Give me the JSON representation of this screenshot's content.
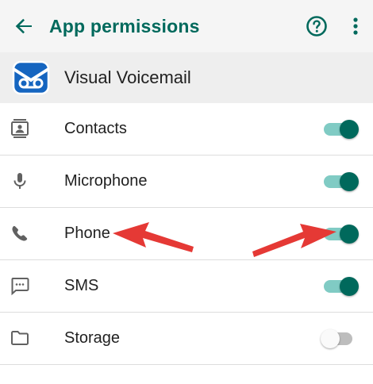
{
  "app_bar": {
    "title": "App permissions",
    "back_icon": "arrow-back-icon",
    "help_icon": "help-circle-icon",
    "more_icon": "more-vert-icon",
    "accent_color": "#00695c"
  },
  "app": {
    "name": "Visual Voicemail",
    "icon": "voicemail-app-icon",
    "icon_color": "#1565c0"
  },
  "permissions": [
    {
      "label": "Contacts",
      "icon": "contacts-icon",
      "enabled": true
    },
    {
      "label": "Microphone",
      "icon": "microphone-icon",
      "enabled": true
    },
    {
      "label": "Phone",
      "icon": "phone-icon",
      "enabled": true
    },
    {
      "label": "SMS",
      "icon": "sms-icon",
      "enabled": true
    },
    {
      "label": "Storage",
      "icon": "folder-icon",
      "enabled": false
    }
  ],
  "annotations": {
    "arrow_color": "#e53935",
    "points_to": [
      "Phone label",
      "Phone toggle"
    ]
  }
}
